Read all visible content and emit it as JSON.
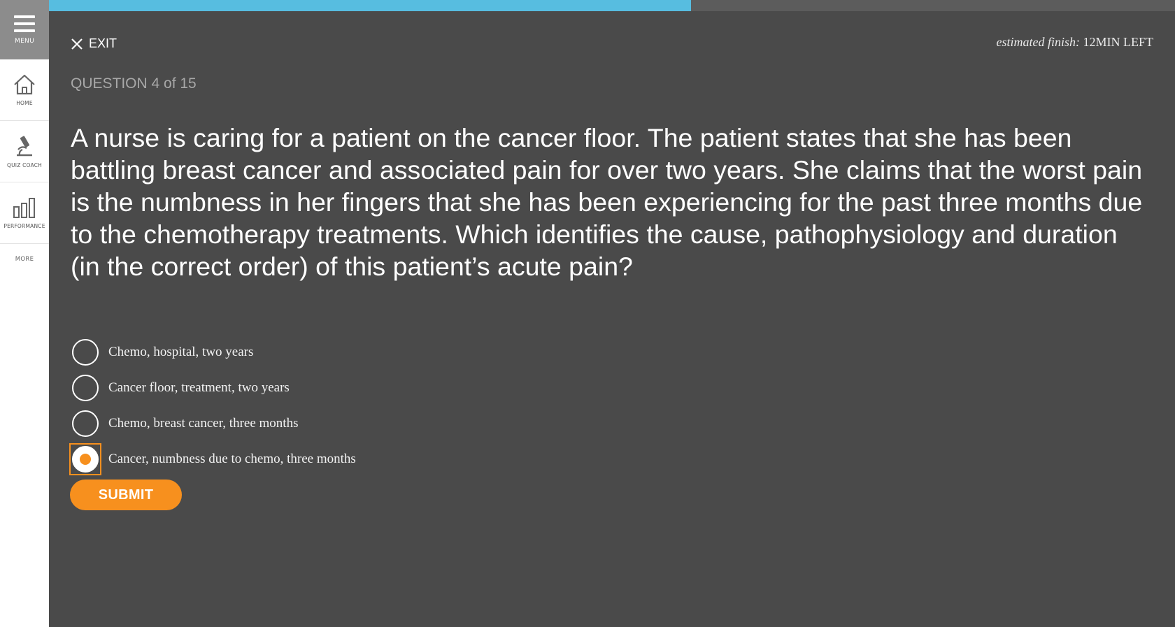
{
  "sidebar": {
    "menu_label": "MENU",
    "items": [
      {
        "label": "HOME",
        "icon": "home-icon"
      },
      {
        "label": "QUIZ COACH",
        "icon": "microscope-icon"
      },
      {
        "label": "PERFORMANCE",
        "icon": "bar-chart-icon"
      }
    ],
    "more_label": "MORE"
  },
  "progress": {
    "fraction": 0.57,
    "fill_color": "#57bde0"
  },
  "header": {
    "exit_label": "EXIT",
    "estimated_prefix": "estimated finish:",
    "estimated_value": "12MIN LEFT"
  },
  "quiz": {
    "question_number": "QUESTION 4 of 15",
    "question_text": "A nurse is caring for a patient on the cancer floor. The patient states that she has been battling breast cancer and associated pain for over two years. She claims that the worst pain is the numbness in her fingers that she has been experiencing for the past three months due to the chemotherapy treatments. Which identifies the cause, pathophysiology and duration (in the correct order) of this patient’s acute pain?",
    "answers": [
      {
        "label": "Chemo, hospital, two years",
        "selected": false
      },
      {
        "label": "Cancer floor, treatment, two years",
        "selected": false
      },
      {
        "label": "Chemo, breast cancer, three months",
        "selected": false
      },
      {
        "label": "Cancer, numbness due to chemo, three months",
        "selected": true
      }
    ],
    "submit_label": "SUBMIT"
  },
  "colors": {
    "accent": "#f7901e",
    "background": "#4a4a4a",
    "progress": "#57bde0"
  }
}
